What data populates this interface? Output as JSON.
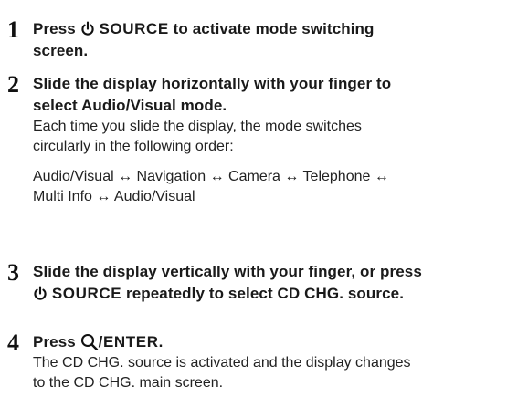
{
  "steps": [
    {
      "number": "1",
      "head_prefix": "Press",
      "power_icon": "power-icon",
      "source_word": "SOURCE",
      "head_suffix": "to activate mode switching",
      "head_line2": "screen."
    },
    {
      "number": "2",
      "head_line1": "Slide the display horizontally with your finger to",
      "head_line2": "select Audio/Visual mode.",
      "body_line1": "Each time you slide the display, the mode switches",
      "body_line2": "circularly in the following order:",
      "sequence_line1": "Audio/Visual ↔ Navigation ↔ Camera ↔ Telephone ↔",
      "sequence_line2": "Multi Info ↔ Audio/Visual"
    },
    {
      "number": "3",
      "head_line1": "Slide the display vertically with your finger, or press",
      "power_icon": "power-icon",
      "source_word": "SOURCE",
      "head_suffix": "repeatedly to select CD CHG. source."
    },
    {
      "number": "4",
      "head_prefix": "Press",
      "search_icon": "search-icon",
      "enter_word": "/ENTER",
      "head_end": ".",
      "body_line1": "The CD CHG. source is activated and the display changes",
      "body_line2": "to the CD CHG. main screen."
    }
  ]
}
